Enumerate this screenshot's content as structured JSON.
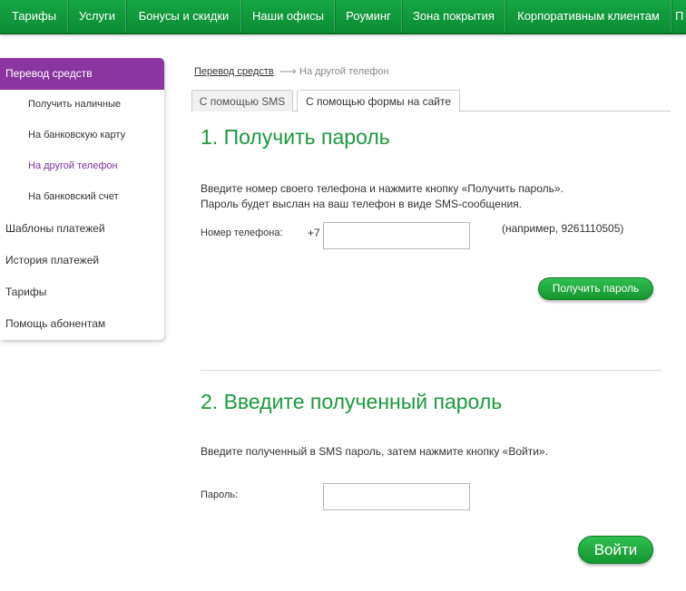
{
  "topnav": {
    "items": [
      "Тарифы",
      "Услуги",
      "Бонусы и скидки",
      "Наши офисы",
      "Роуминг",
      "Зона покрытия",
      "Корпоративным клиентам",
      "П"
    ]
  },
  "sidebar": {
    "active_label": "Перевод средств",
    "sub_items": [
      "Получить наличные",
      "На банковскую карту",
      "На другой телефон",
      "На банковский счет"
    ],
    "current_sub": "На другой телефон",
    "items": [
      "Шаблоны платежей",
      "История платежей",
      "Тарифы",
      "Помощь абонентам"
    ]
  },
  "breadcrumb": {
    "link": "Перевод средств",
    "arrow": "⟶",
    "current": "На другой телефон"
  },
  "tabs": {
    "sms": "С помощью SMS",
    "form": "С помощью формы на сайте",
    "active": "form"
  },
  "step1": {
    "title": "1. Получить пароль",
    "line1": "Введите номер своего телефона и нажмите кнопку «Получить пароль».",
    "line2": "Пароль будет выслан на ваш телефон в виде SMS-сообщения.",
    "phone_label": "Номер телефона:",
    "phone_prefix": "+7",
    "phone_value": "",
    "phone_hint": "(например, 9261110505)",
    "button": "Получить пароль"
  },
  "step2": {
    "title": "2. Введите полученный пароль",
    "instruction": "Введите полученный в SMS пароль, затем нажмите кнопку «Войти».",
    "password_label": "Пароль:",
    "password_value": "",
    "button": "Войти"
  },
  "colors": {
    "brand_green": "#15a542",
    "heading_green": "#1a9a3c",
    "accent_purple": "#8a35a0"
  }
}
